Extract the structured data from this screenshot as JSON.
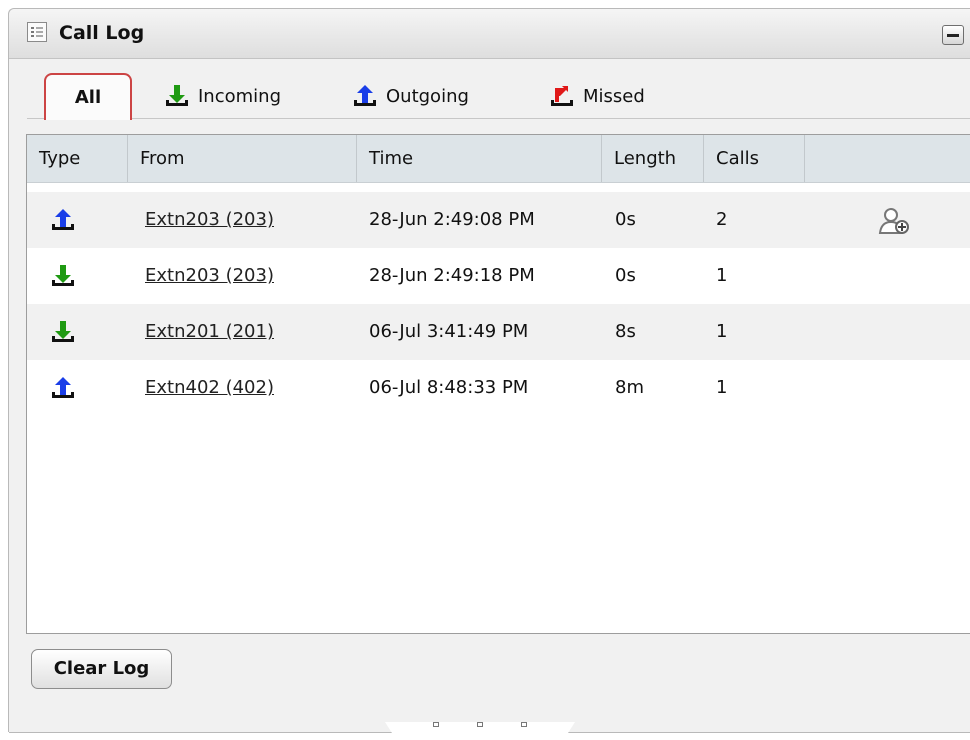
{
  "window": {
    "title": "Call Log"
  },
  "tabs": [
    {
      "label": "All",
      "icon": "none",
      "active": true
    },
    {
      "label": "Incoming",
      "icon": "incoming-arrow-icon",
      "color": "#1f9a12"
    },
    {
      "label": "Outgoing",
      "icon": "outgoing-arrow-icon",
      "color": "#1a3ee8"
    },
    {
      "label": "Missed",
      "icon": "missed-arrow-icon",
      "color": "#e01818"
    }
  ],
  "table": {
    "columns": [
      "Type",
      "From",
      "Time",
      "Length",
      "Calls",
      ""
    ],
    "rows": [
      {
        "type": "outgoing",
        "from": "Extn203 (203)",
        "time": "28-Jun 2:49:08 PM",
        "length": "0s",
        "calls": "2",
        "action_icon": "add-contact-icon"
      },
      {
        "type": "incoming",
        "from": "Extn203 (203)",
        "time": "28-Jun 2:49:18 PM",
        "length": "0s",
        "calls": "1"
      },
      {
        "type": "incoming",
        "from": "Extn201 (201)",
        "time": "06-Jul 3:41:49 PM",
        "length": "8s",
        "calls": "1"
      },
      {
        "type": "outgoing",
        "from": "Extn402 (402)",
        "time": "06-Jul 8:48:33 PM",
        "length": "8m",
        "calls": "1"
      }
    ]
  },
  "buttons": {
    "clear_log": "Clear Log"
  },
  "colors": {
    "incoming": "#1f9a12",
    "outgoing": "#1a3ee8",
    "missed": "#e01818",
    "active_tab_border": "#cc4444"
  }
}
